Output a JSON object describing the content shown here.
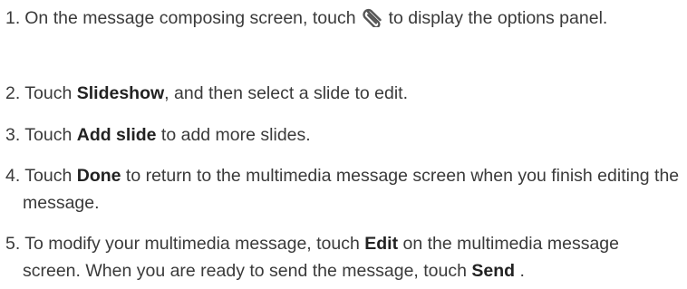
{
  "steps": [
    {
      "number": "1.",
      "text_before": "On the message composing screen, touch",
      "icon": "paperclip-icon",
      "text_after": "to display the options panel."
    },
    {
      "number": "2.",
      "text_before": "Touch",
      "bold": "Slideshow",
      "text_after": ", and then select a slide to edit."
    },
    {
      "number": "3.",
      "text_before": "Touch",
      "bold": "Add slide",
      "text_after": "to add more slides."
    },
    {
      "number": "4.",
      "text_before": "Touch",
      "bold": "Done",
      "text_after": "to return to the multimedia message screen when you finish editing the message."
    },
    {
      "number": "5.",
      "text_before": "To modify your multimedia message, touch",
      "bold": "Edit",
      "text_middle": "on the multimedia message screen. When you are ready to send the message, touch",
      "bold2": "Send",
      "text_after": "."
    }
  ],
  "colors": {
    "text": "#3a3a3a",
    "bold": "#222222",
    "icon": "#555555"
  }
}
